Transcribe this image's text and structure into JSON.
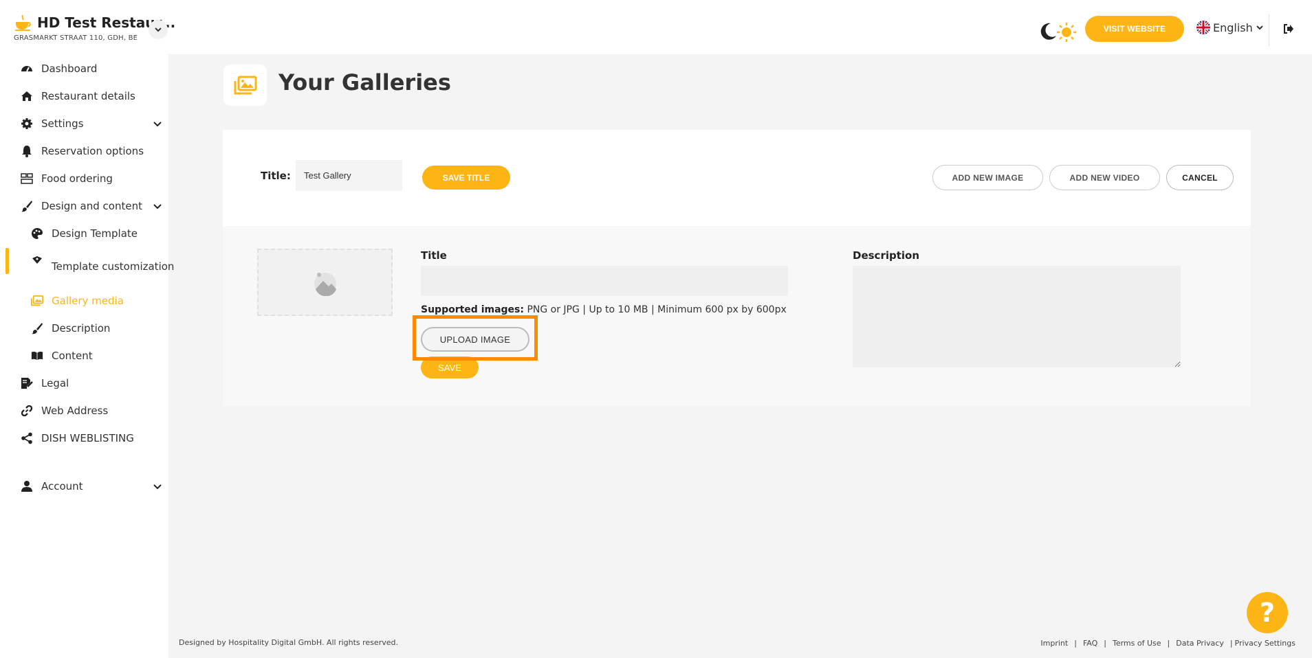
{
  "header": {
    "restaurant_name": "HD Test Restaur...",
    "restaurant_address": "GRASMARKT STRAAT 110, GDH, BE",
    "visit_website_label": "VISIT WEBSITE",
    "language_label": "English",
    "accent_color": "#fdb515"
  },
  "sidebar": {
    "items": [
      {
        "label": "Dashboard",
        "icon": "dashboard-icon"
      },
      {
        "label": "Restaurant details",
        "icon": "home-icon"
      },
      {
        "label": "Settings",
        "icon": "gear-icon"
      },
      {
        "label": "Reservation options",
        "icon": "bell-icon"
      },
      {
        "label": "Food ordering",
        "icon": "food-ordering-icon"
      },
      {
        "label": "Design and content",
        "icon": "brush-icon"
      },
      {
        "label": "Design Template",
        "icon": "palette-icon"
      },
      {
        "label": "Template customization",
        "icon": "customization-icon"
      },
      {
        "label": "Gallery media",
        "icon": "images-icon"
      },
      {
        "label": "Description",
        "icon": "pen-icon"
      },
      {
        "label": "Content",
        "icon": "book-icon"
      },
      {
        "label": "Legal",
        "icon": "legal-icon"
      },
      {
        "label": "Web Address",
        "icon": "link-icon"
      },
      {
        "label": "DISH WEBLISTING",
        "icon": "share-icon"
      },
      {
        "label": "Account",
        "icon": "user-icon"
      }
    ],
    "active_item": "Gallery media"
  },
  "main": {
    "page_title": "Your Galleries",
    "gallery": {
      "title_label": "Title:",
      "title_value": "Test Gallery",
      "save_title_label": "SAVE TITLE",
      "add_new_image_label": "ADD NEW IMAGE",
      "add_new_video_label": "ADD NEW VIDEO",
      "cancel_label": "CANCEL"
    },
    "image_form": {
      "title_label": "Title",
      "title_value": "",
      "description_label": "Description",
      "description_value": "",
      "supported_label": "Supported images:",
      "supported_text": "PNG or JPG | Up to 10 MB | Minimum 600 px by 600px",
      "upload_label": "UPLOAD IMAGE",
      "save_label": "SAVE"
    }
  },
  "footer": {
    "copyright": "Designed by Hospitality Digital GmbH. All rights reserved.",
    "links": [
      "Imprint",
      "FAQ",
      "Terms of Use",
      "Data Privacy",
      "Privacy Settings"
    ]
  },
  "help": {
    "label": "?"
  }
}
